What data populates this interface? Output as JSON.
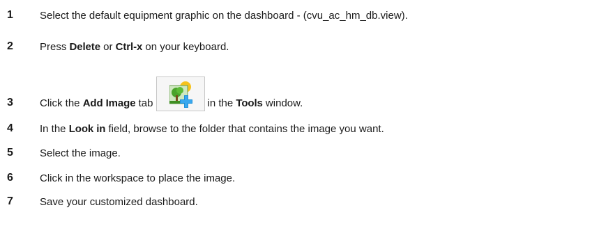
{
  "steps": [
    {
      "number": "1",
      "text": "Select the default equipment graphic on the dashboard - (cvu_ac_hm_db.view)."
    },
    {
      "number": "2",
      "parts": [
        "Press ",
        "Delete",
        " or ",
        "Ctrl-x",
        " on your keyboard."
      ]
    },
    {
      "number": "3",
      "parts": [
        "Click the ",
        "Add Image",
        " tab ",
        " in the ",
        "Tools",
        " window."
      ],
      "icon": "add-image-tab-icon"
    },
    {
      "number": "4",
      "parts": [
        "In the ",
        "Look in",
        " field, browse to the folder that contains the image you want."
      ]
    },
    {
      "number": "5",
      "text": "Select the image."
    },
    {
      "number": "6",
      "text": "Click in the workspace to place the image."
    },
    {
      "number": "7",
      "text": "Save your customized dashboard."
    }
  ],
  "colors": {
    "icon_green": "#4aa32a",
    "icon_blue": "#1a8fd8",
    "icon_sun": "#f6c21c"
  }
}
